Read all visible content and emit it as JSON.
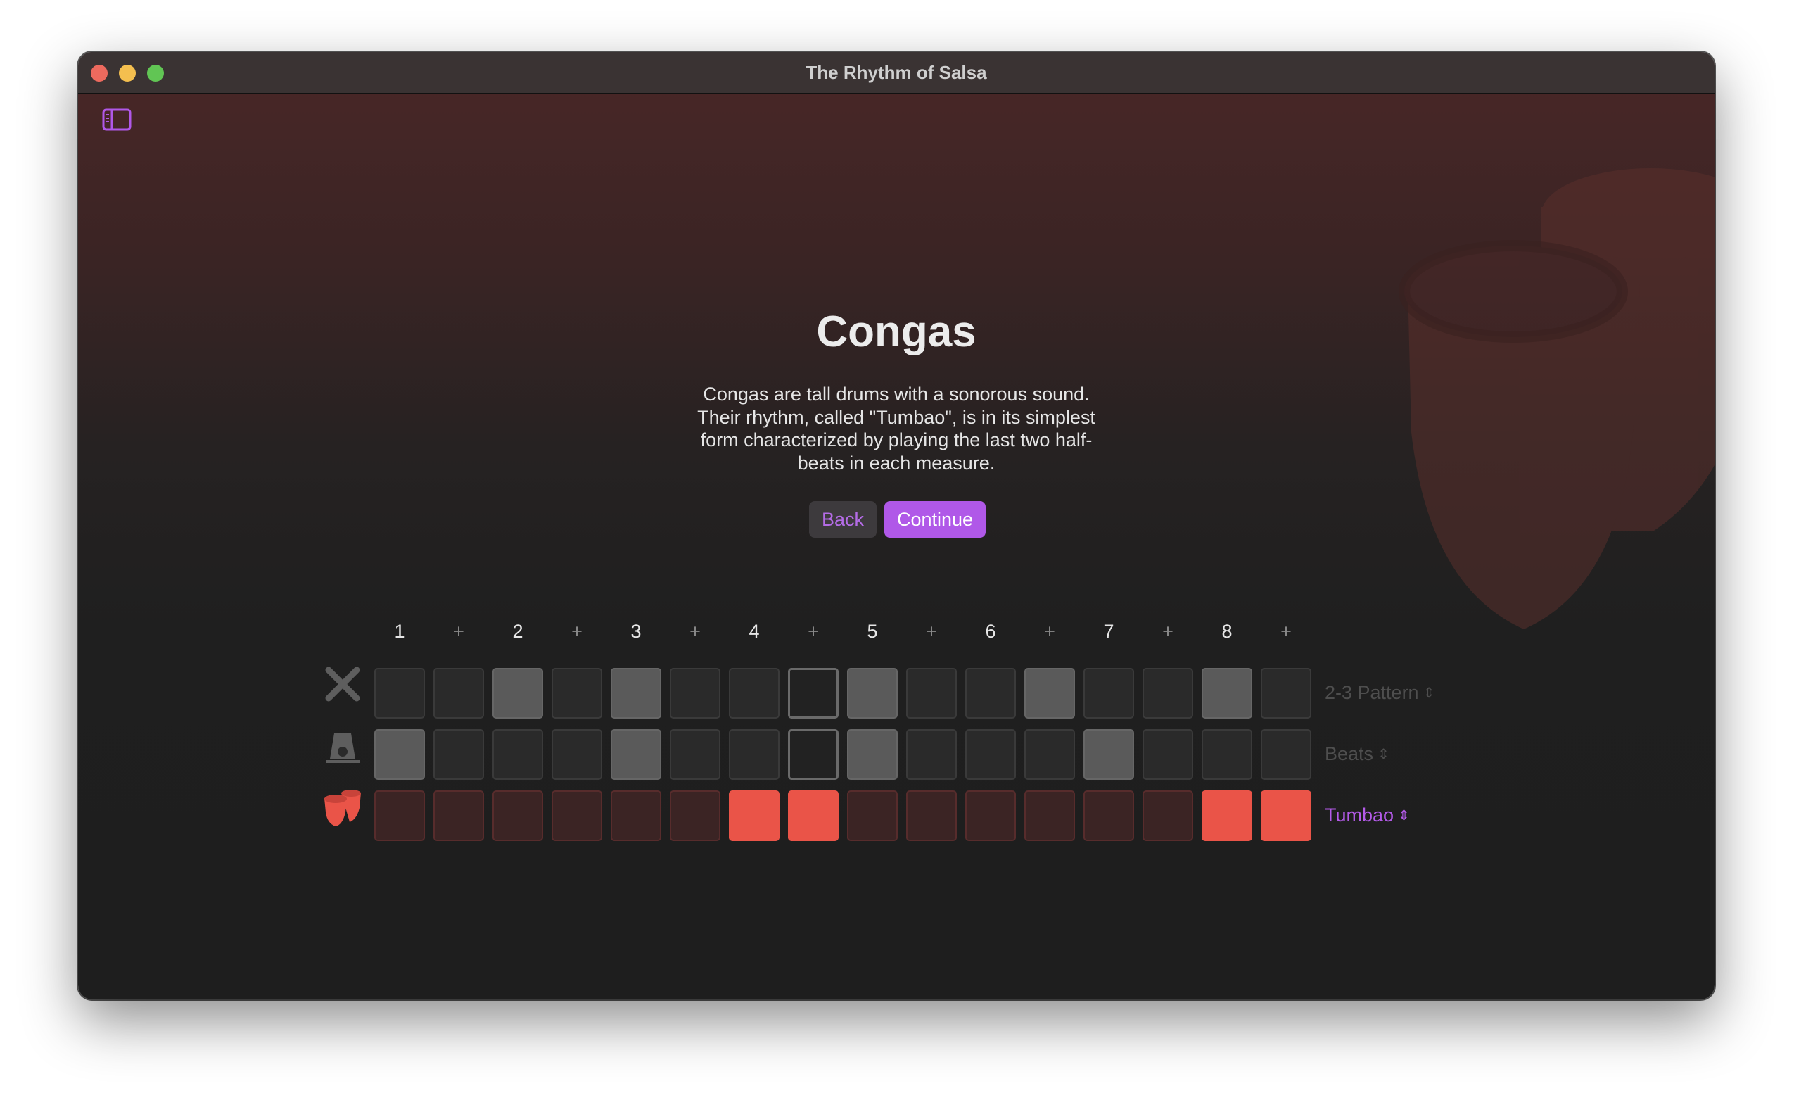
{
  "window": {
    "title": "The Rhythm of Salsa"
  },
  "content": {
    "heading": "Congas",
    "description": "Congas are tall drums with a sonorous sound. Their rhythm, called \"Tumbao\", is in its simplest form characterized by playing the last two half-beats in each measure.",
    "back_label": "Back",
    "continue_label": "Continue"
  },
  "sequencer": {
    "beat_labels": [
      "1",
      "+",
      "2",
      "+",
      "3",
      "+",
      "4",
      "+",
      "5",
      "+",
      "6",
      "+",
      "7",
      "+",
      "8",
      "+"
    ],
    "current_step": 8,
    "rows": [
      {
        "icon": "claves-icon",
        "pattern_label": "2-3 Pattern",
        "active": false,
        "steps": [
          0,
          0,
          1,
          0,
          1,
          0,
          0,
          0,
          1,
          0,
          0,
          1,
          0,
          0,
          1,
          0
        ]
      },
      {
        "icon": "cowbell-icon",
        "pattern_label": "Beats",
        "active": false,
        "steps": [
          1,
          0,
          0,
          0,
          1,
          0,
          0,
          0,
          1,
          0,
          0,
          0,
          1,
          0,
          0,
          0
        ]
      },
      {
        "icon": "congas-icon",
        "pattern_label": "Tumbao",
        "active": true,
        "steps": [
          0,
          0,
          0,
          0,
          0,
          0,
          1,
          1,
          0,
          0,
          0,
          0,
          0,
          0,
          1,
          1
        ]
      }
    ]
  },
  "colors": {
    "accent": "#b058e8",
    "conga_on": "#ea5448",
    "background": "#1e1e1e"
  }
}
